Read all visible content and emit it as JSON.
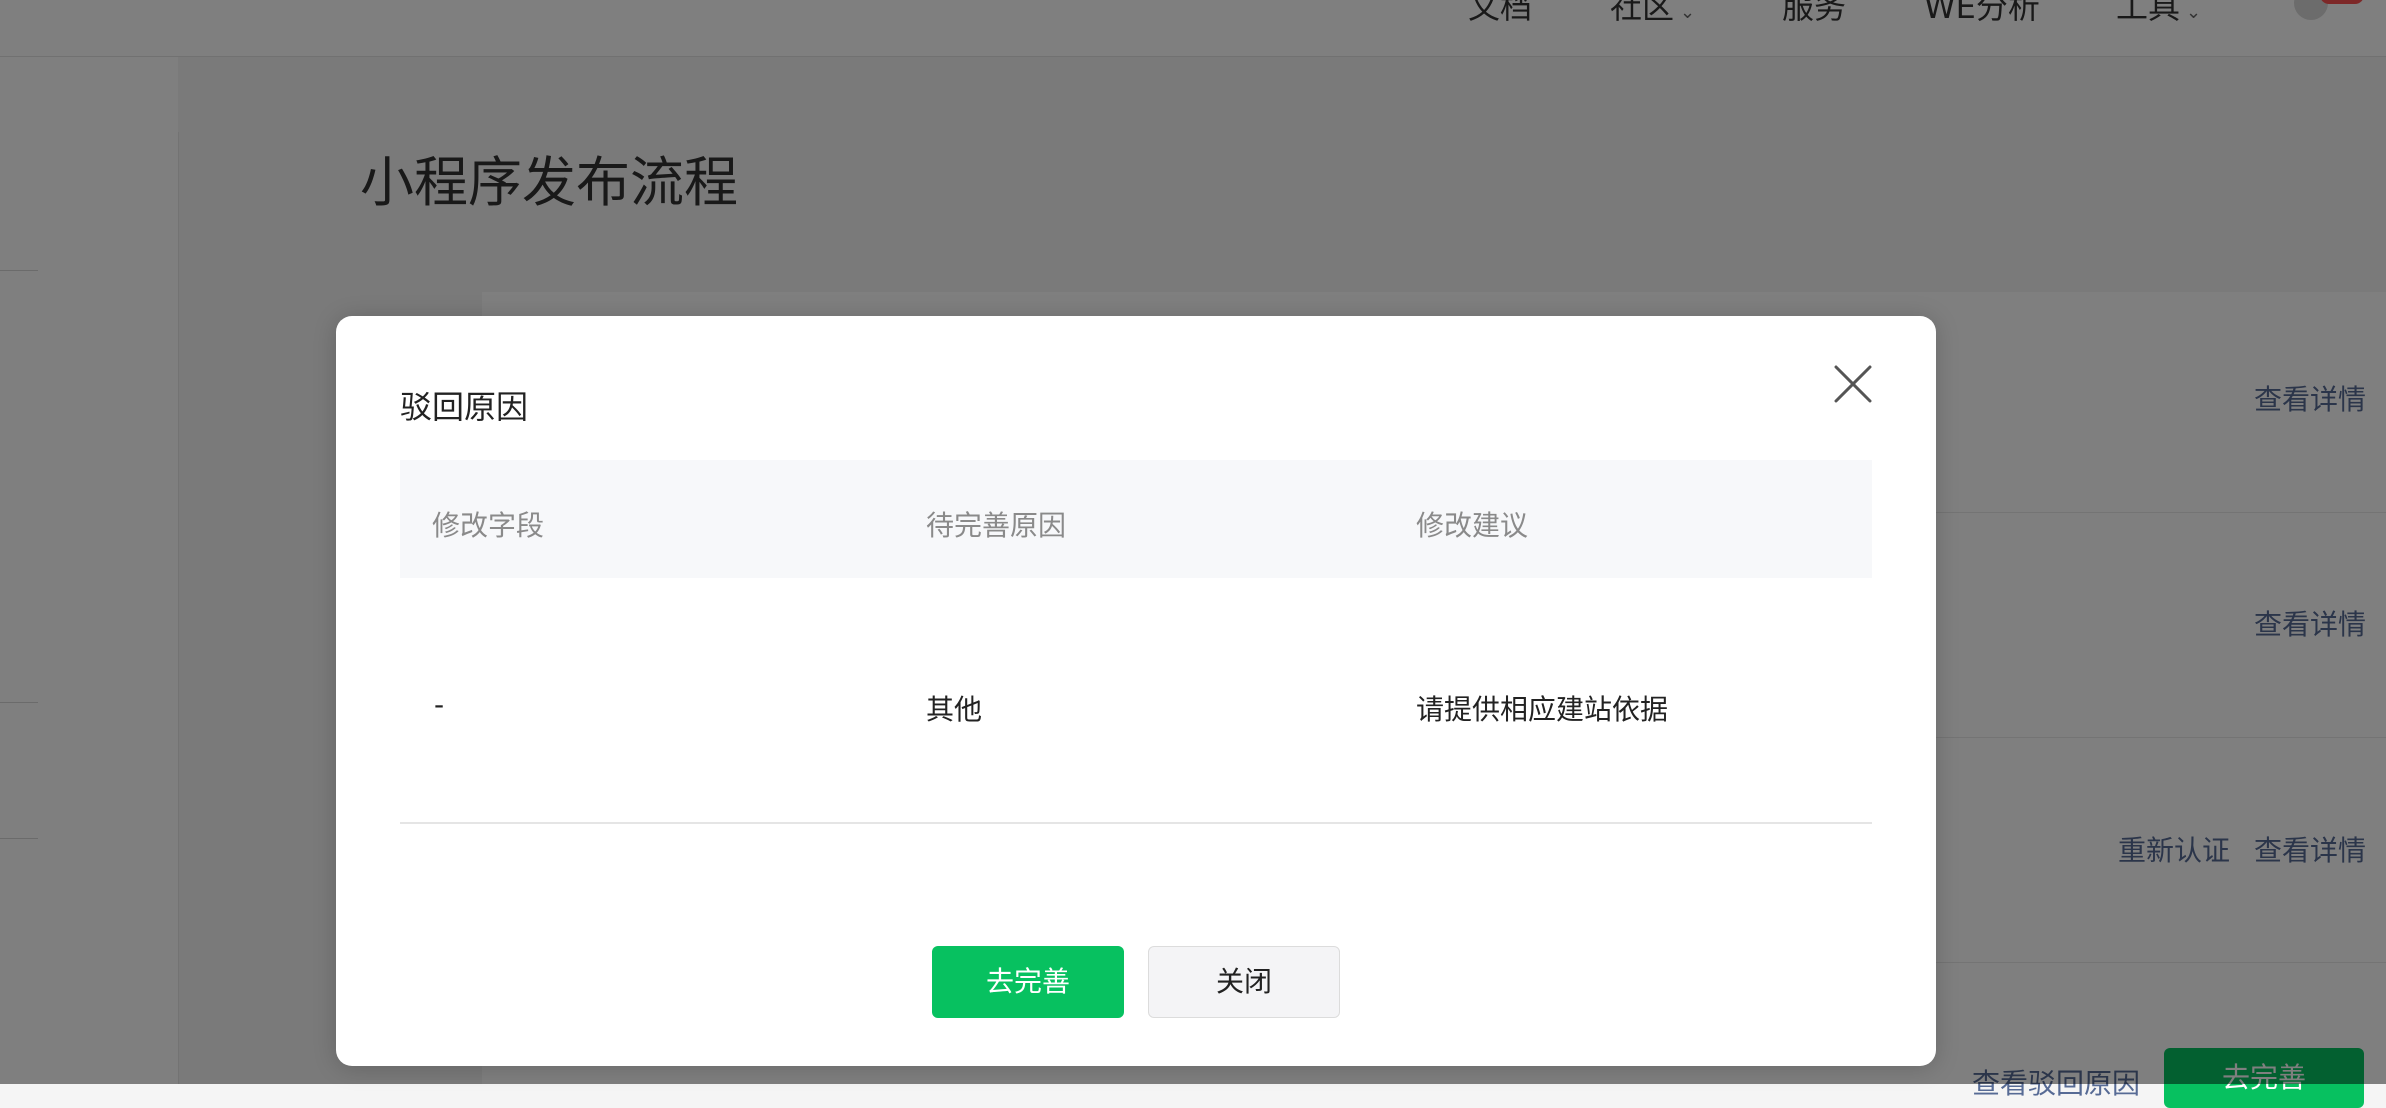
{
  "background": {
    "nav": [
      {
        "label": "文档",
        "has_caret": false
      },
      {
        "label": "社区",
        "has_caret": true
      },
      {
        "label": "服务",
        "has_caret": false
      },
      {
        "label": "WE分析",
        "has_caret": false
      },
      {
        "label": "工具",
        "has_caret": true
      }
    ],
    "page_title": "小程序发布流程",
    "rows": [
      {
        "actions": [
          "查看详情"
        ]
      },
      {
        "actions": [
          "查看详情"
        ]
      },
      {
        "actions": [
          "重新认证",
          "查看详情"
        ]
      },
      {
        "actions": [
          "查看驳回原因",
          "去完善"
        ]
      }
    ],
    "nav_caret": "⌄"
  },
  "modal": {
    "title": "驳回原因",
    "columns": [
      "修改字段",
      "待完善原因",
      "修改建议"
    ],
    "rows": [
      [
        "-",
        "其他",
        "请提供相应建站依据"
      ]
    ],
    "primary_button": "去完善",
    "secondary_button": "关闭"
  },
  "colors": {
    "primary_green": "#07c160",
    "link_blue": "#576b95"
  }
}
